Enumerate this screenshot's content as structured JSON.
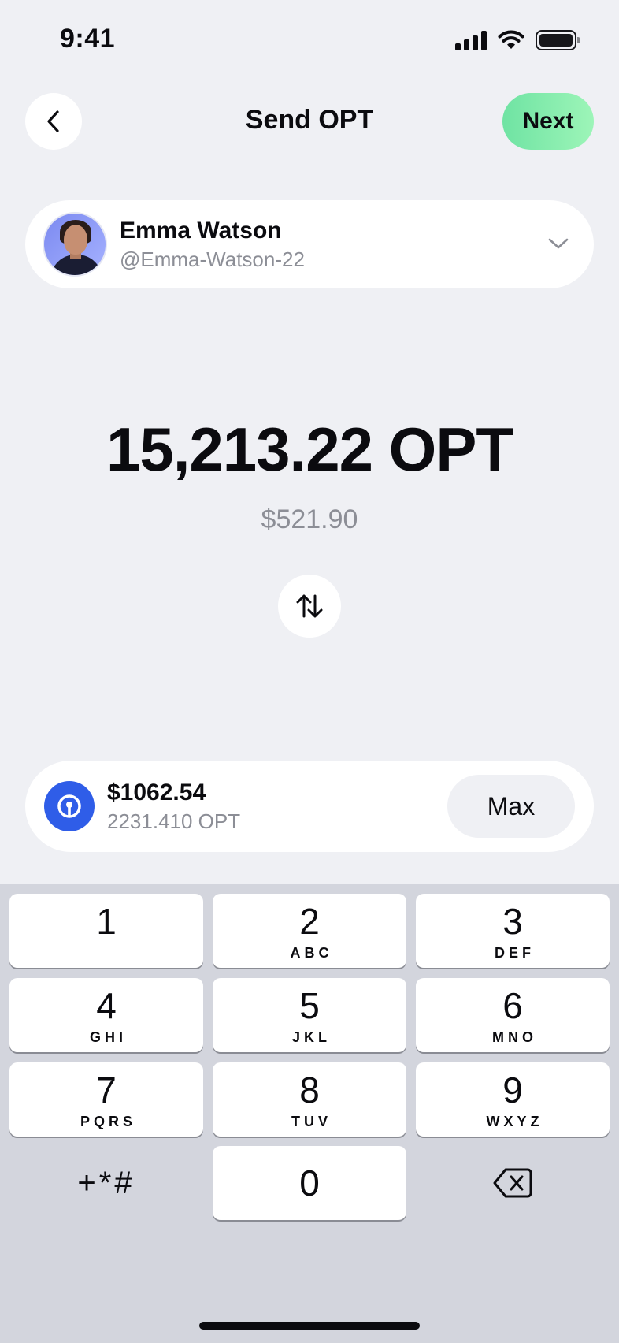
{
  "status_bar": {
    "time": "9:41"
  },
  "header": {
    "title": "Send OPT",
    "next_label": "Next"
  },
  "recipient": {
    "name": "Emma Watson",
    "handle": "@Emma-Watson-22"
  },
  "amount": {
    "token_amount": "15,213.22 OPT",
    "fiat_amount": "$521.90"
  },
  "balance": {
    "fiat": "$1062.54",
    "token": "2231.410 OPT",
    "max_label": "Max"
  },
  "keypad": {
    "keys": [
      {
        "digit": "1",
        "letters": ""
      },
      {
        "digit": "2",
        "letters": "ABC"
      },
      {
        "digit": "3",
        "letters": "DEF"
      },
      {
        "digit": "4",
        "letters": "GHI"
      },
      {
        "digit": "5",
        "letters": "JKL"
      },
      {
        "digit": "6",
        "letters": "MNO"
      },
      {
        "digit": "7",
        "letters": "PQRS"
      },
      {
        "digit": "8",
        "letters": "TUV"
      },
      {
        "digit": "9",
        "letters": "WXYZ"
      }
    ],
    "symbols_label": "+*#",
    "zero": "0"
  },
  "colors": {
    "accent_green": "#7ae8a8",
    "token_blue": "#2f5de8",
    "background": "#eff0f4",
    "keypad_bg": "#d3d5dd"
  }
}
